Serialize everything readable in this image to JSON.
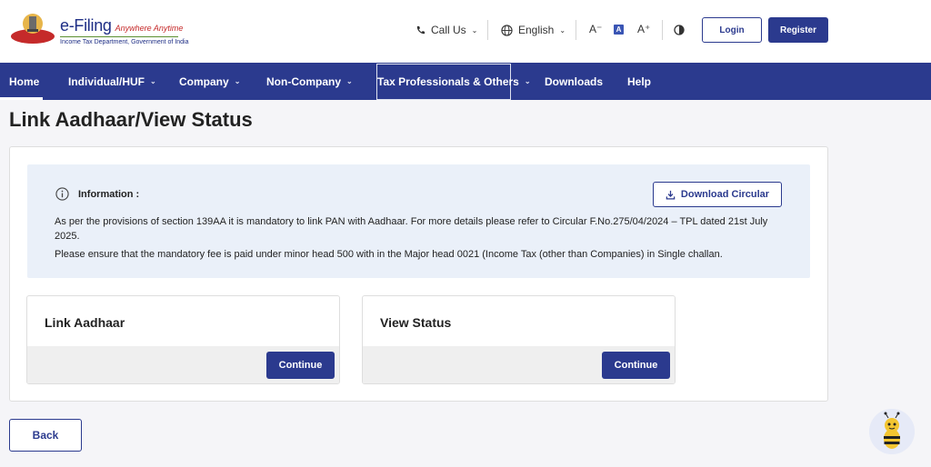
{
  "header": {
    "brand_title": "e-Filing",
    "brand_tagline": "Anywhere Anytime",
    "brand_subtitle": "Income Tax Department, Government of India",
    "call_us": "Call Us",
    "language": "English",
    "font_decrease": "A⁻",
    "font_default": "A",
    "font_increase": "A⁺",
    "login": "Login",
    "register": "Register"
  },
  "nav": {
    "items": [
      {
        "label": "Home"
      },
      {
        "label": "Individual/HUF"
      },
      {
        "label": "Company"
      },
      {
        "label": "Non-Company"
      },
      {
        "label": "Tax Professionals & Others"
      },
      {
        "label": "Downloads"
      },
      {
        "label": "Help"
      }
    ]
  },
  "page": {
    "title": "Link Aadhaar/View Status",
    "info_heading": "Information :",
    "info_text_1": "As per the provisions of section 139AA it is mandatory to link PAN with Aadhaar. For more details please refer to Circular F.No.275/04/2024 – TPL dated 21st July 2025.",
    "info_text_2": "Please ensure that the mandatory fee is paid under minor head 500 with in the Major head 0021 (Income Tax (other than Companies) in Single challan.",
    "download_circular": "Download Circular",
    "cards": [
      {
        "title": "Link Aadhaar",
        "button": "Continue"
      },
      {
        "title": "View Status",
        "button": "Continue"
      }
    ],
    "back": "Back"
  },
  "colors": {
    "primary": "#2b3a8e",
    "info_bg": "#eaf0f9"
  }
}
